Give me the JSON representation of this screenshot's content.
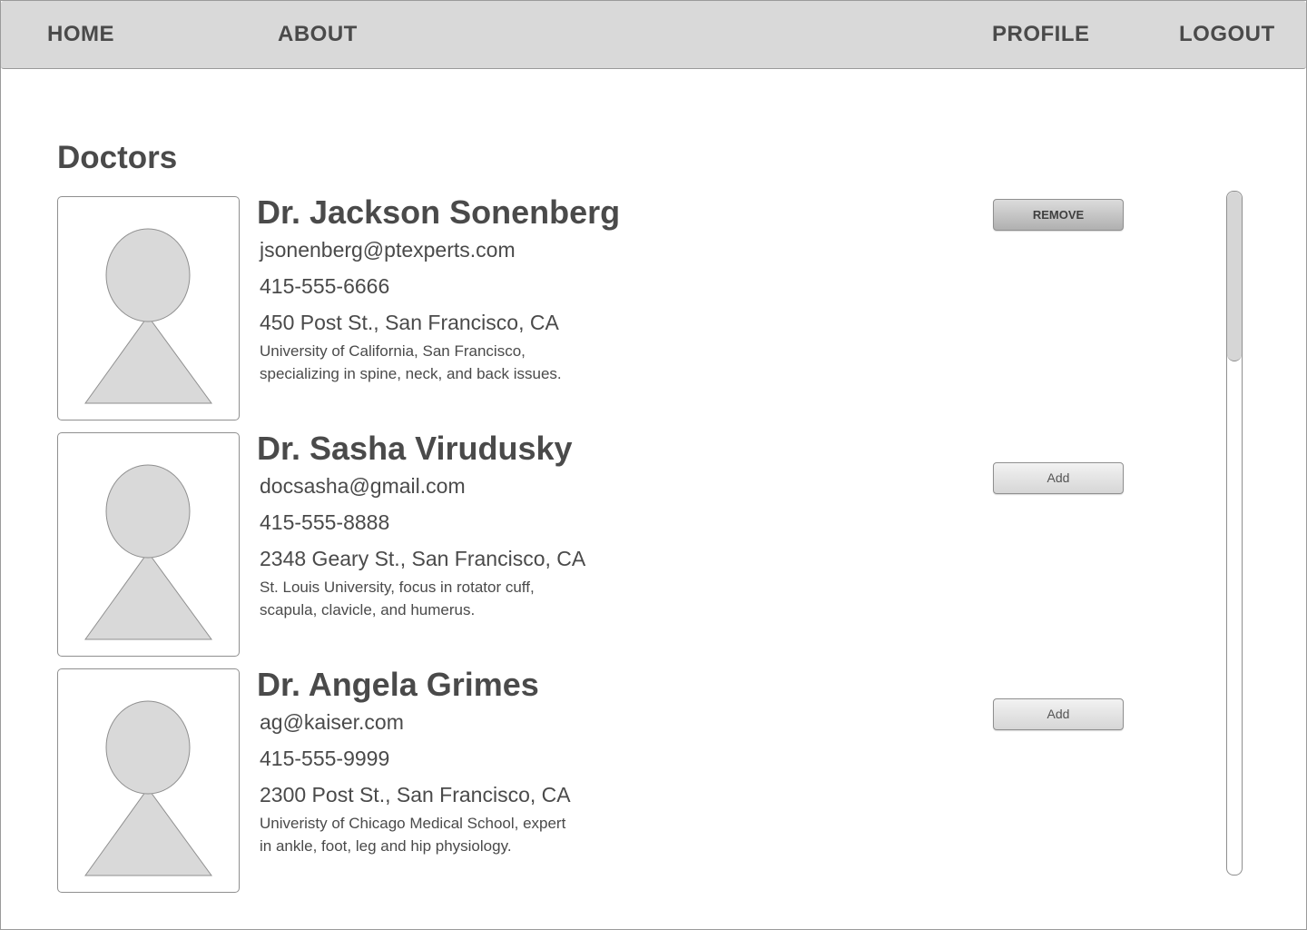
{
  "nav": {
    "home": "HOME",
    "about": "ABOUT",
    "profile": "PROFILE",
    "logout": "LOGOUT"
  },
  "page": {
    "title": "Doctors"
  },
  "doctors": [
    {
      "name": "Dr. Jackson Sonenberg",
      "email": "jsonenberg@ptexperts.com",
      "phone": "415-555-6666",
      "address": "450 Post St., San Francisco, CA",
      "bio": "University of California, San Francisco, specializing in  spine, neck, and back issues.",
      "action": "REMOVE"
    },
    {
      "name": "Dr. Sasha Virudusky",
      "email": "docsasha@gmail.com",
      "phone": "415-555-8888",
      "address": "2348 Geary St., San Francisco, CA",
      "bio": "St. Louis University, focus in rotator cuff, scapula, clavicle, and humerus.",
      "action": "Add"
    },
    {
      "name": "Dr. Angela Grimes",
      "email": "ag@kaiser.com",
      "phone": "415-555-9999",
      "address": "2300 Post St., San Francisco, CA",
      "bio": "Univeristy of Chicago Medical School, expert in ankle, foot, leg and hip physiology.",
      "action": "Add"
    }
  ],
  "scroll": {
    "position_fraction": 0.0
  },
  "icons": {
    "avatar": "person-placeholder-icon"
  },
  "colors": {
    "navbar_bg": "#d9d9d9",
    "text": "#4a4a4a",
    "placeholder_fill": "#d9d9d9"
  }
}
